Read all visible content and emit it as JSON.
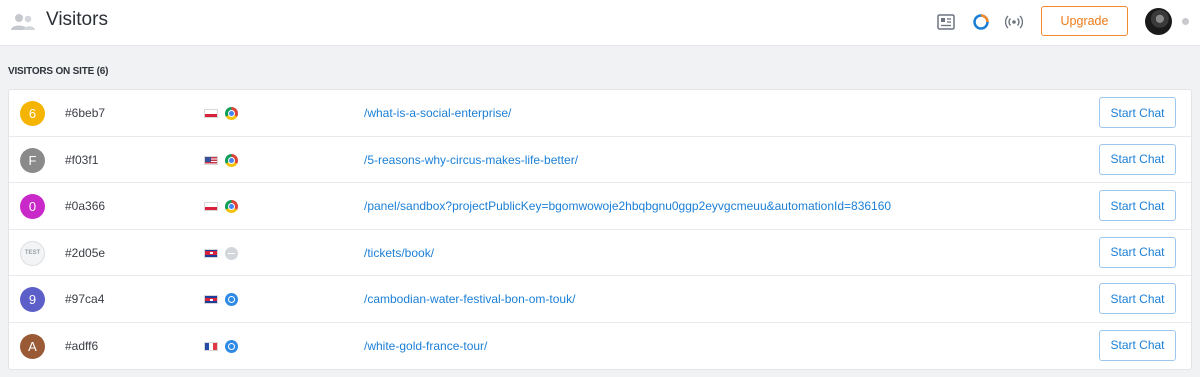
{
  "header": {
    "title": "Visitors",
    "upgrade_label": "Upgrade",
    "icons": [
      "people-icon",
      "newspaper-icon",
      "loading-ring-icon",
      "broadcast-icon"
    ],
    "accent_color": "#f28a2c"
  },
  "section": {
    "title": "VISITORS ON SITE (6)"
  },
  "visitors": [
    {
      "avatar_text": "6",
      "avatar_color": "#f5b400",
      "id": "#6beb7",
      "flag": "pl",
      "browser": "chrome",
      "url": "/what-is-a-social-enterprise/",
      "action": "Start Chat"
    },
    {
      "avatar_text": "F",
      "avatar_color": "#8a8a8a",
      "id": "#f03f1",
      "flag": "us",
      "browser": "chrome",
      "url": "/5-reasons-why-circus-makes-life-better/",
      "action": "Start Chat"
    },
    {
      "avatar_text": "0",
      "avatar_color": "#c929c9",
      "id": "#0a366",
      "flag": "pl",
      "browser": "chrome",
      "url": "/panel/sandbox?projectPublicKey=bgomwowoje2hbqbgnu0ggp2eyvgcmeuu&automationId=836160",
      "action": "Start Chat"
    },
    {
      "avatar_text": "TEST",
      "avatar_color": "#f3f4f6",
      "id": "#2d05e",
      "flag": "kh",
      "browser": "unknown",
      "url": "/tickets/book/",
      "action": "Start Chat"
    },
    {
      "avatar_text": "9",
      "avatar_color": "#5b5fc7",
      "id": "#97ca4",
      "flag": "kh",
      "browser": "safari",
      "url": "/cambodian-water-festival-bon-om-touk/",
      "action": "Start Chat"
    },
    {
      "avatar_text": "A",
      "avatar_color": "#9a5a36",
      "id": "#adff6",
      "flag": "fr",
      "browser": "safari",
      "url": "/white-gold-france-tour/",
      "action": "Start Chat"
    }
  ]
}
